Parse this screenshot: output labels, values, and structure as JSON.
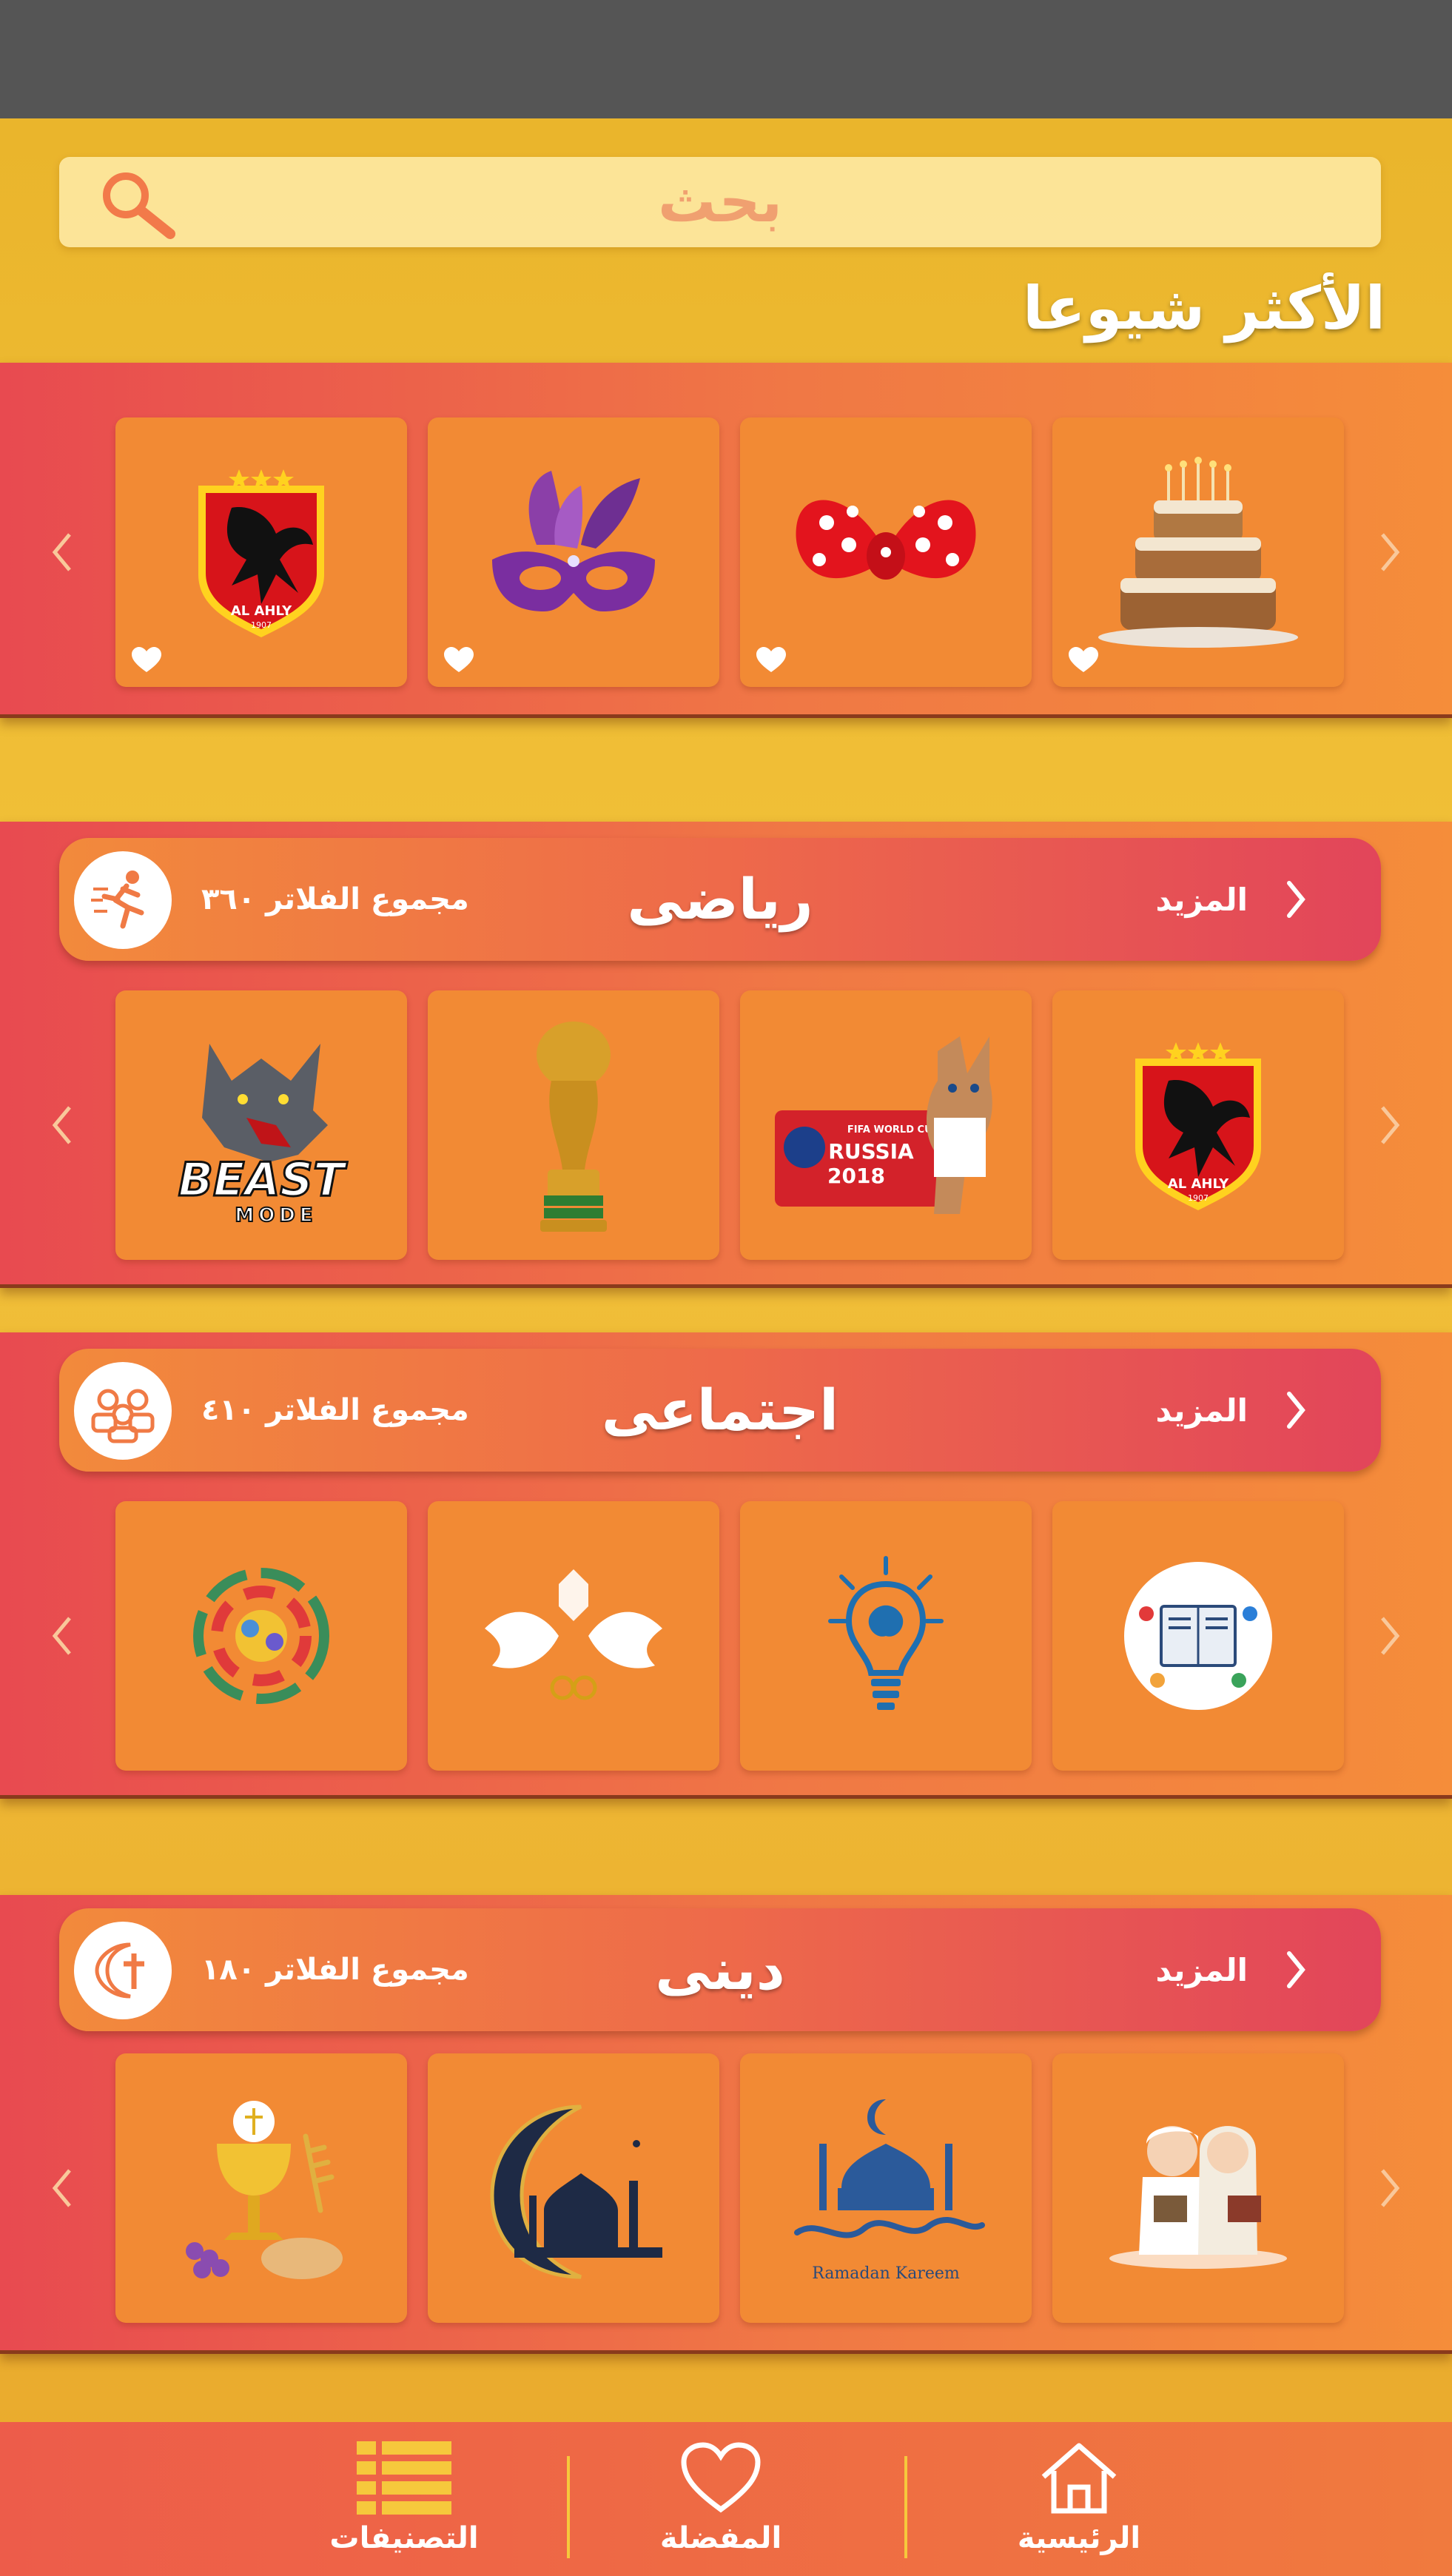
{
  "search": {
    "placeholder": "بحث"
  },
  "popular": {
    "title": "الأكثر شيوعا",
    "items": [
      "birthday-cake",
      "polka-dot-bow",
      "purple-carnival-mask",
      "al-ahly-badge"
    ]
  },
  "al_ahly_badge": {
    "team": "AL AHLY",
    "year": "1907"
  },
  "categories": [
    {
      "title": "رياضى",
      "count_label": "مجموع الفلاتر ٣٦٠",
      "more_label": "المزيد",
      "icon": "runner-icon",
      "items": [
        "al-ahly-badge",
        "world-cup-2018-mascot",
        "world-cup-trophy",
        "beast-mode-wolf"
      ]
    },
    {
      "title": "اجتماعى",
      "count_label": "مجموع الفلاتر ٤١٠",
      "more_label": "المزيد",
      "icon": "people-icon",
      "items": [
        "education-circle",
        "idea-bulb",
        "wedding-doves",
        "community-circle"
      ]
    },
    {
      "title": "دينى",
      "count_label": "مجموع الفلاتر ١٨٠",
      "more_label": "المزيد",
      "icon": "crescent-cross-icon",
      "items": [
        "kids-reading-quran",
        "ramadan-kareem-mosque",
        "crescent-mosque",
        "chalice-bread-grapes"
      ]
    }
  ],
  "world_cup_badge": {
    "line1": "FIFA WORLD CUP",
    "line2": "RUSSIA",
    "line3": "2018"
  },
  "beast_logo": {
    "line1": "BEAST",
    "line2": "MODE"
  },
  "ramadan_text": {
    "latin": "Ramadan Kareem"
  },
  "nav": {
    "home": "الرئيسية",
    "favorites": "المفضلة",
    "categories": "التصنيفات"
  },
  "colors": {
    "band_start": "#e84a50",
    "band_end": "#f58d3a",
    "card": "#f28a34",
    "nav_divider": "#f6c83c"
  }
}
